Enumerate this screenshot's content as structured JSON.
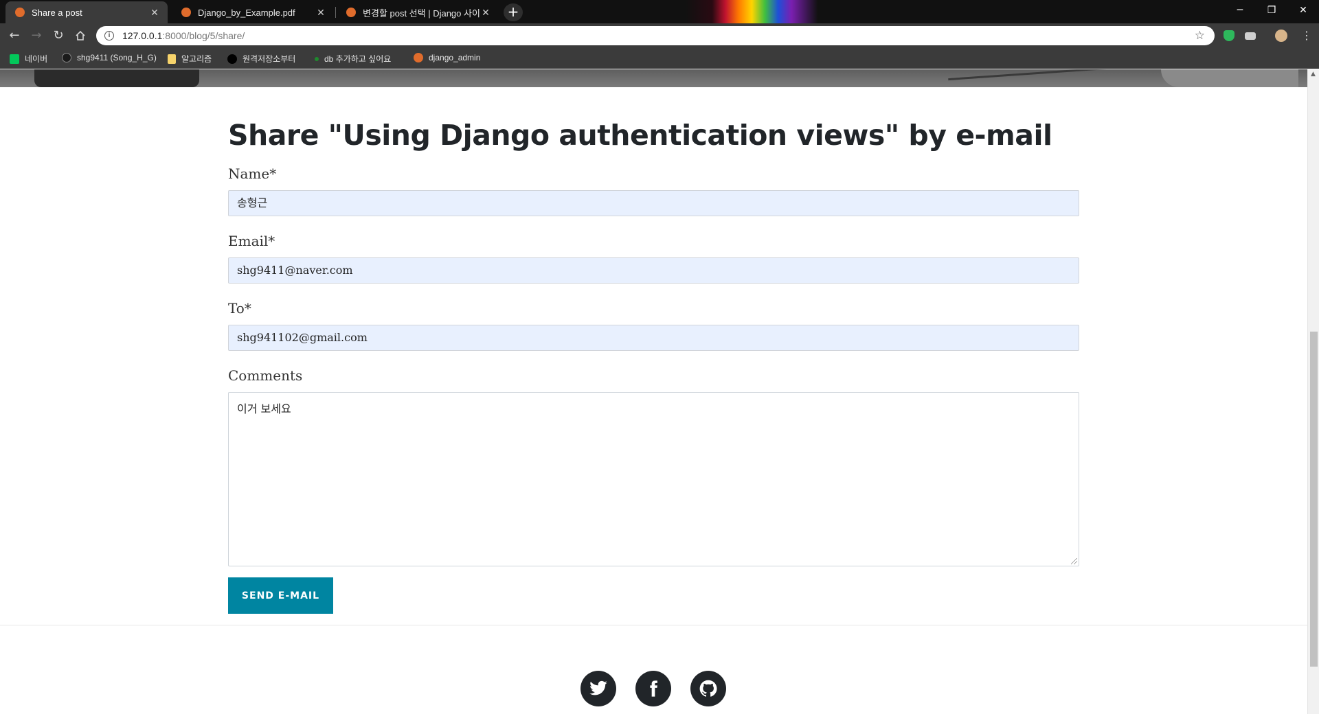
{
  "browser": {
    "tabs": [
      {
        "title": "Share a post",
        "active": true
      },
      {
        "title": "Django_by_Example.pdf",
        "active": false
      },
      {
        "title": "변경할 post 선택 | Django 사이",
        "active": false
      }
    ],
    "new_tab_label": "+",
    "window_controls": {
      "minimize": "─",
      "restore": "❐",
      "close": "✕"
    },
    "url": {
      "host": "127.0.0.1",
      "path": ":8000/blog/5/share/"
    },
    "bookmarks": [
      {
        "label": "네이버",
        "icon": "naver-icon",
        "color": "#03c75a"
      },
      {
        "label": "shg9411 (Song_H_G)",
        "icon": "github-icon",
        "color": "#1b1b1b"
      },
      {
        "label": "알고리즘",
        "icon": "folder-icon",
        "color": "#f6d36b"
      },
      {
        "label": "원격저장소부터",
        "icon": "circle-icon",
        "color": "#000000"
      },
      {
        "label": "db 추가하고 싶어요",
        "icon": "leaf-icon",
        "color": "#1f8a2e"
      },
      {
        "label": "django_admin",
        "icon": "django-favicon-icon",
        "color": "#e06c2c"
      }
    ]
  },
  "page": {
    "title": "Share \"Using Django authentication views\" by e-mail",
    "form": {
      "name_label": "Name*",
      "name_value": "송형근",
      "email_label": "Email*",
      "email_value": "shg9411@naver.com",
      "to_label": "To*",
      "to_value": "shg941102@gmail.com",
      "comments_label": "Comments",
      "comments_value": "이거 보세요",
      "submit_label": "SEND E-MAIL"
    },
    "footer": {
      "social": [
        "twitter-icon",
        "facebook-icon",
        "github-icon"
      ]
    },
    "colors": {
      "accent": "#0085a1",
      "autofill": "#e8f0fe",
      "heading": "#212529"
    }
  }
}
